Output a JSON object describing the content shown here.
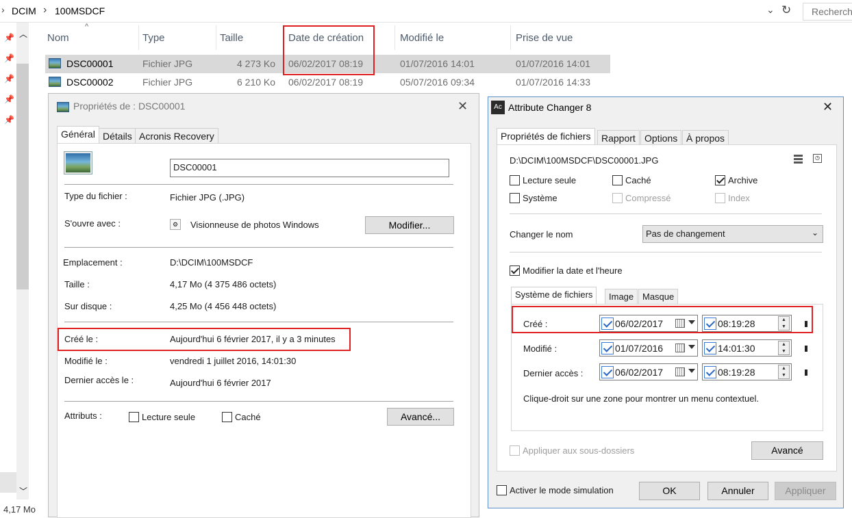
{
  "explorer": {
    "breadcrumb": [
      "DCIM",
      "100MSDCF"
    ],
    "search_placeholder": "Recherch",
    "columns": [
      "Nom",
      "Type",
      "Taille",
      "Date de création",
      "Modifié le",
      "Prise de vue"
    ],
    "rows": [
      {
        "name": "DSC00001",
        "type": "Fichier JPG",
        "size": "4 273 Ko",
        "created": "06/02/2017 08:19",
        "modified": "01/07/2016 14:01",
        "taken": "01/07/2016 14:01"
      },
      {
        "name": "DSC00002",
        "type": "Fichier JPG",
        "size": "6 210 Ko",
        "created": "06/02/2017 08:19",
        "modified": "05/07/2016 09:34",
        "taken": "01/07/2016 14:33"
      }
    ],
    "status": "4,17 Mo"
  },
  "props": {
    "title": "Propriétés de : DSC00001",
    "tabs": [
      "Général",
      "Détails",
      "Acronis Recovery"
    ],
    "filename": "DSC00001",
    "type_label": "Type du fichier :",
    "type_value": "Fichier JPG (.JPG)",
    "opens_label": "S'ouvre avec :",
    "opens_value": "Visionneuse de photos Windows",
    "change_btn": "Modifier...",
    "loc_label": "Emplacement :",
    "loc_value": "D:\\DCIM\\100MSDCF",
    "size_label": "Taille :",
    "size_value": "4,17 Mo (4 375 486 octets)",
    "disk_label": "Sur disque :",
    "disk_value": "4,25 Mo (4 456 448 octets)",
    "created_label": "Créé le :",
    "created_value": "Aujourd'hui 6 février 2017, il y a 3 minutes",
    "modified_label": "Modifié le :",
    "modified_value": "vendredi 1 juillet 2016, 14:01:30",
    "access_label": "Dernier accès le :",
    "access_value": "Aujourd'hui 6 février 2017",
    "attr_label": "Attributs :",
    "readonly": "Lecture seule",
    "hidden": "Caché",
    "advanced_btn": "Avancé..."
  },
  "ac": {
    "title": "Attribute Changer 8",
    "app_icon": "Ac",
    "tabs": [
      "Propriétés de fichiers",
      "Rapport",
      "Options",
      "À propos"
    ],
    "path": "D:\\DCIM\\100MSDCF\\DSC00001.JPG",
    "attrs": {
      "readonly": "Lecture seule",
      "hidden": "Caché",
      "archive": "Archive",
      "system": "Système",
      "compressed": "Compressé",
      "index": "Index"
    },
    "rename_label": "Changer le nom",
    "rename_value": "Pas de changement",
    "modify_dt": "Modifier la date et l'heure",
    "subtabs": [
      "Système de fichiers",
      "Image",
      "Masque"
    ],
    "created_label": "Créé :",
    "created_date": "06/02/2017",
    "created_time": "08:19:28",
    "modified_label": "Modifié :",
    "modified_date": "01/07/2016",
    "modified_time": "14:01:30",
    "access_label": "Dernier accès :",
    "access_date": "06/02/2017",
    "access_time": "08:19:28",
    "hint": "Clique-droit sur une zone pour montrer un menu contextuel.",
    "apply_sub": "Appliquer aux sous-dossiers",
    "advanced_btn": "Avancé",
    "sim_mode": "Activer le mode simulation",
    "ok": "OK",
    "cancel": "Annuler",
    "apply": "Appliquer"
  },
  "colors": {
    "highlight": "#e02020",
    "selected_row": "#d9d9d9",
    "accent": "#3a7bd5"
  }
}
